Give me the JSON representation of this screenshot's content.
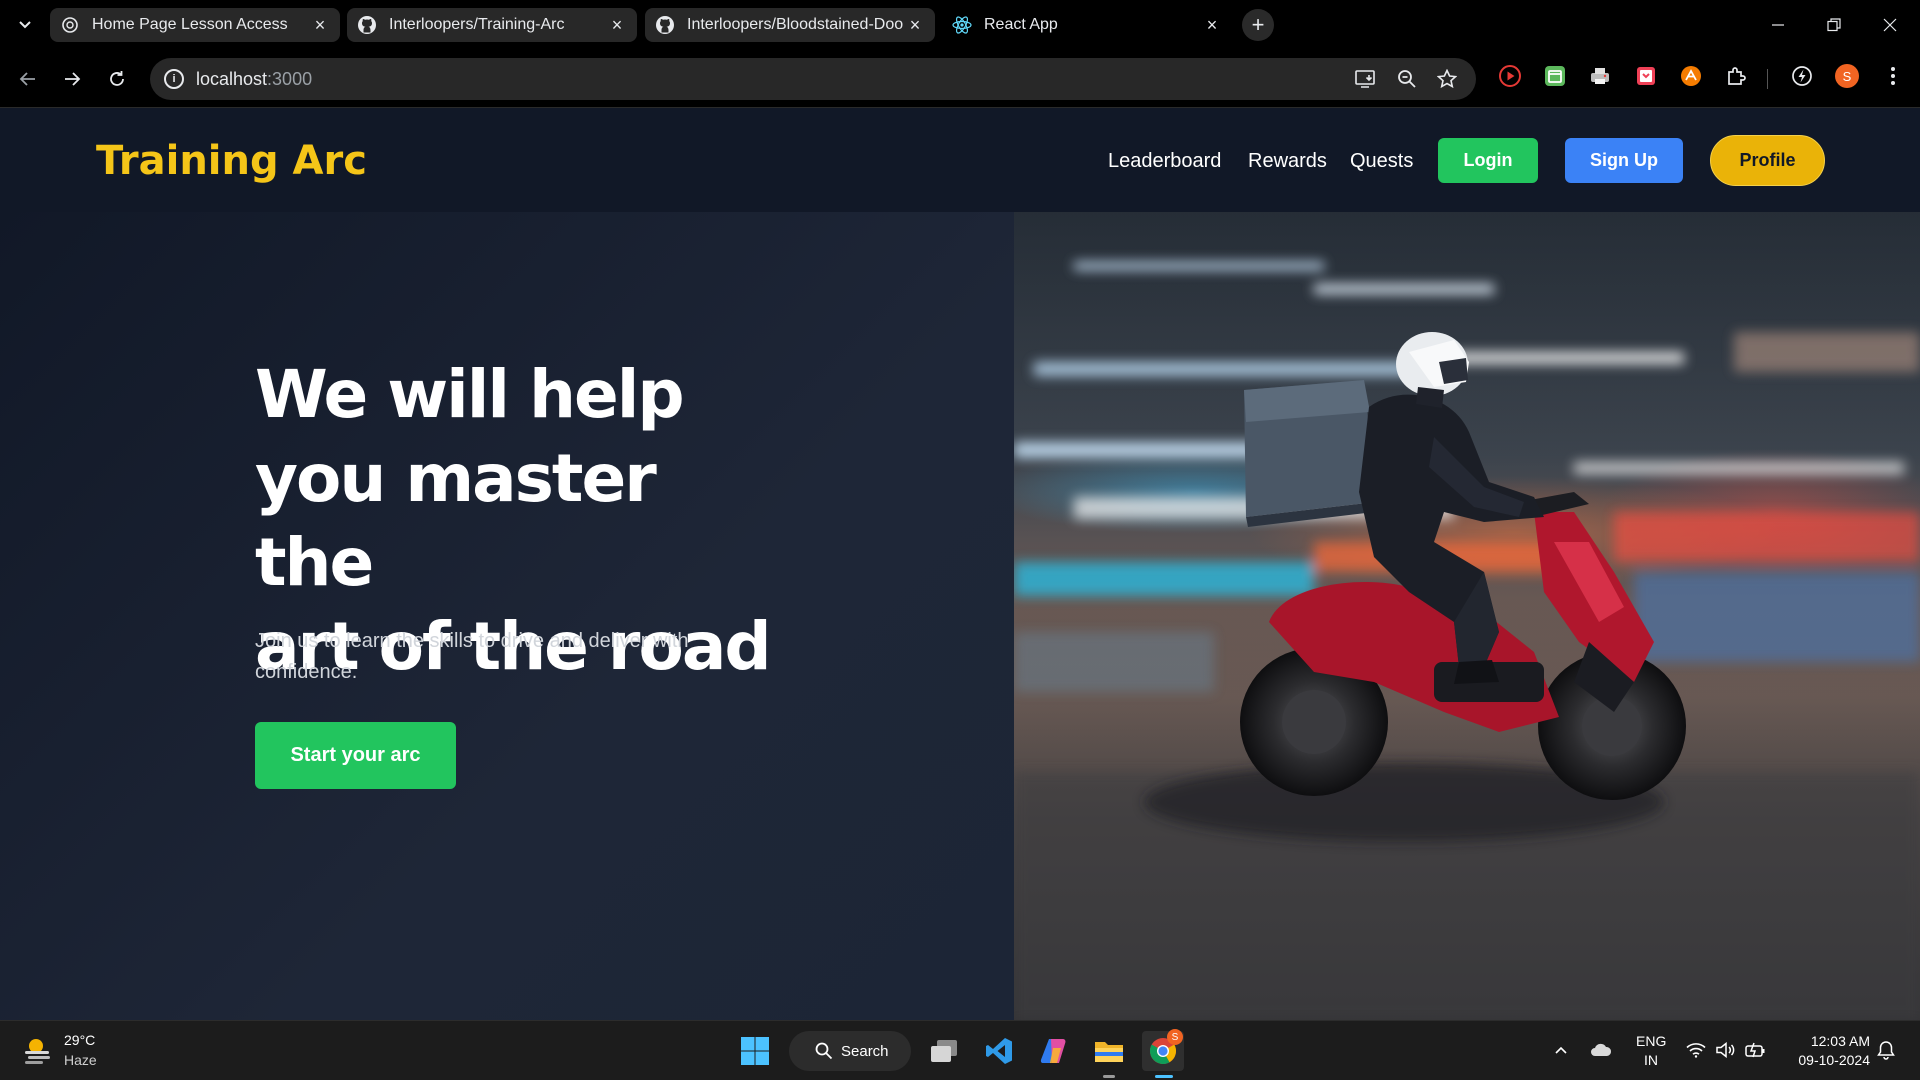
{
  "browser": {
    "tabs": [
      {
        "title": "Home Page Lesson Access",
        "state": "open",
        "favicon": "openai-icon"
      },
      {
        "title": "Interloopers/Training-Arc",
        "state": "open",
        "favicon": "github-icon"
      },
      {
        "title": "Interloopers/Bloodstained-Doo",
        "state": "open",
        "favicon": "github-icon"
      },
      {
        "title": "React App",
        "state": "active",
        "favicon": "react-icon"
      }
    ],
    "url_host": "localhost",
    "url_port": ":3000",
    "profile_initial": "S"
  },
  "site": {
    "logo": "Training Arc",
    "nav": {
      "leaderboard": "Leaderboard",
      "rewards": "Rewards",
      "quests": "Quests",
      "login": "Login",
      "signup": "Sign Up",
      "profile": "Profile"
    },
    "hero": {
      "title_line1": "We will help",
      "title_line2": "you master the",
      "title_line3": "art of the road",
      "subtitle": "Join us to learn the skills to drive and deliver with confidence.",
      "cta": "Start your arc"
    },
    "colors": {
      "logo": "#f5c518",
      "login": "#22c55e",
      "signup": "#3b82f6",
      "profile": "#eab308",
      "cta": "#22c55e",
      "background": "#111827"
    }
  },
  "taskbar": {
    "temperature": "29°C",
    "condition": "Haze",
    "search": "Search",
    "lang_line1": "ENG",
    "lang_line2": "IN",
    "time": "12:03 AM",
    "date": "09-10-2024",
    "chrome_badge": "S"
  }
}
